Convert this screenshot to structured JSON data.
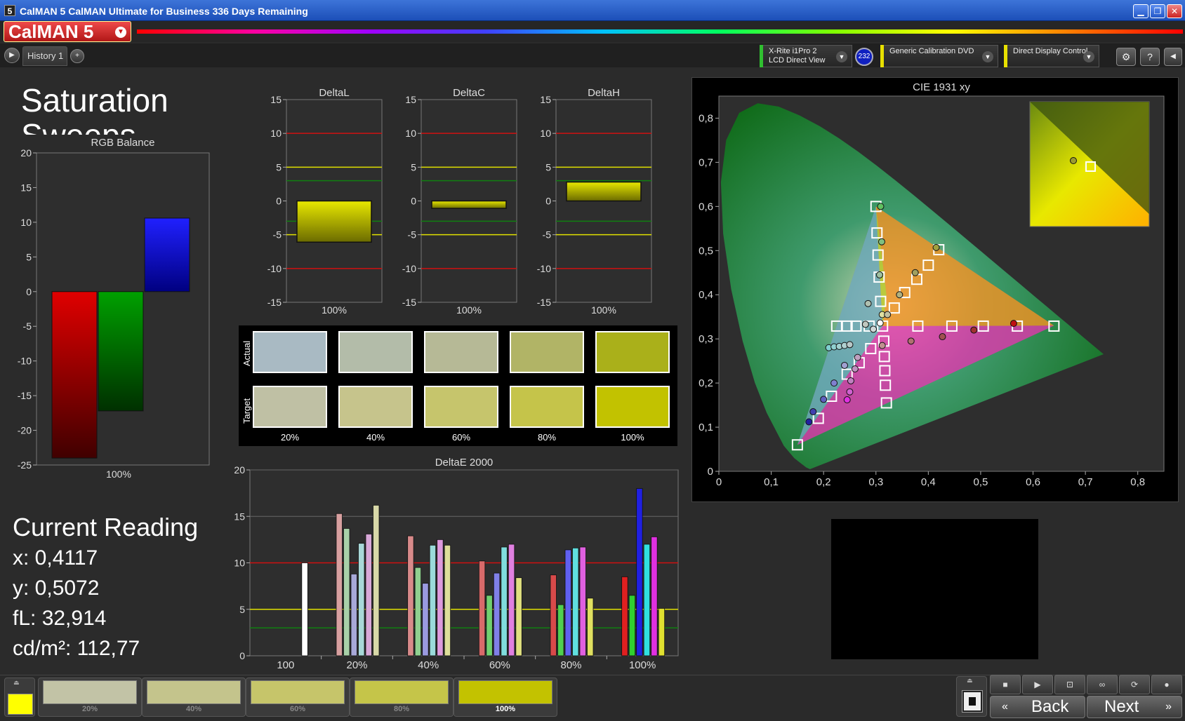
{
  "window": {
    "title": "CalMAN 5 CalMAN Ultimate for Business 336 Days Remaining",
    "logo": "CalMAN 5"
  },
  "tabs": [
    {
      "label": "History 1"
    }
  ],
  "devices": {
    "meter": {
      "line1": "X-Rite i1Pro 2",
      "line2": "LCD Direct View",
      "badge": "232",
      "color": "#30c030"
    },
    "source": {
      "label": "Generic Calibration DVD",
      "color": "#e8e000"
    },
    "display": {
      "label": "Direct Display Control",
      "color": "#e8e000"
    }
  },
  "page": {
    "title": "Saturation Sweeps"
  },
  "current_reading": {
    "heading": "Current Reading",
    "x": "x: 0,4117",
    "y": "y: 0,5072",
    "fl": "fL: 32,914",
    "cdm2": "cd/m²: 112,77"
  },
  "swatches": {
    "row_labels": [
      "Actual",
      "Target"
    ],
    "labels": [
      "20%",
      "40%",
      "60%",
      "80%",
      "100%"
    ],
    "actual_colors": [
      "#a9bac3",
      "#b3bca9",
      "#b6b996",
      "#b1b466",
      "#aab01a"
    ],
    "target_colors": [
      "#bfc0a4",
      "#c6c48c",
      "#c6c56c",
      "#c5c44a",
      "#c2c200"
    ]
  },
  "progress": {
    "labels": [
      "20%",
      "40%",
      "60%",
      "80%",
      "100%"
    ],
    "colors": [
      "#c2c3a6",
      "#c4c48c",
      "#c6c56a",
      "#c5c549",
      "#c3c200"
    ],
    "active_index": 4,
    "current_color": "#ffff00"
  },
  "nav": {
    "back": "Back",
    "next": "Next"
  },
  "chart_data": [
    {
      "type": "bar",
      "title": "RGB Balance",
      "categories": [
        "100%"
      ],
      "series": [
        {
          "values": [
            -24
          ],
          "color": "#e00000"
        },
        {
          "values": [
            -17.2
          ],
          "color": "#00a000"
        },
        {
          "values": [
            10.6
          ],
          "color": "#0000ff"
        }
      ],
      "ylim": [
        -25,
        20
      ],
      "yticks": [
        -25,
        -20,
        -15,
        -10,
        -5,
        0,
        5,
        10,
        15,
        20
      ]
    },
    {
      "type": "bar",
      "title": "DeltaL",
      "categories": [
        "100%"
      ],
      "values": [
        -6.1
      ],
      "ylim": [
        -15,
        15
      ],
      "yticks": [
        -15,
        -10,
        -5,
        0,
        5,
        10,
        15
      ],
      "reference_lines": [
        {
          "y": 10,
          "color": "#d01010"
        },
        {
          "y": -10,
          "color": "#d01010"
        },
        {
          "y": 5,
          "color": "#e0e000"
        },
        {
          "y": -5,
          "color": "#e0e000"
        },
        {
          "y": 3,
          "color": "#108010"
        },
        {
          "y": -3,
          "color": "#108010"
        }
      ]
    },
    {
      "type": "bar",
      "title": "DeltaC",
      "categories": [
        "100%"
      ],
      "values": [
        -1.1
      ],
      "ylim": [
        -15,
        15
      ],
      "yticks": [
        -15,
        -10,
        -5,
        0,
        5,
        10,
        15
      ],
      "reference_lines": [
        {
          "y": 10,
          "color": "#d01010"
        },
        {
          "y": -10,
          "color": "#d01010"
        },
        {
          "y": 5,
          "color": "#e0e000"
        },
        {
          "y": -5,
          "color": "#e0e000"
        },
        {
          "y": 3,
          "color": "#108010"
        },
        {
          "y": -3,
          "color": "#108010"
        }
      ]
    },
    {
      "type": "bar",
      "title": "DeltaH",
      "categories": [
        "100%"
      ],
      "values": [
        2.8
      ],
      "ylim": [
        -15,
        15
      ],
      "yticks": [
        -15,
        -10,
        -5,
        0,
        5,
        10,
        15
      ],
      "reference_lines": [
        {
          "y": 10,
          "color": "#d01010"
        },
        {
          "y": -10,
          "color": "#d01010"
        },
        {
          "y": 5,
          "color": "#e0e000"
        },
        {
          "y": -5,
          "color": "#e0e000"
        },
        {
          "y": 3,
          "color": "#108010"
        },
        {
          "y": -3,
          "color": "#108010"
        }
      ]
    },
    {
      "type": "bar",
      "title": "DeltaE 2000",
      "categories": [
        "100",
        "20%",
        "40%",
        "60%",
        "80%",
        "100%"
      ],
      "ylim": [
        0,
        20
      ],
      "yticks": [
        0,
        5,
        10,
        15,
        20
      ],
      "reference_lines": [
        {
          "y": 10,
          "color": "#d01010"
        },
        {
          "y": 5,
          "color": "#e0e000"
        },
        {
          "y": 3,
          "color": "#108010"
        }
      ],
      "series": [
        {
          "name": "red",
          "values": [
            null,
            15.3,
            12.9,
            10.2,
            8.7,
            8.5
          ],
          "colors": [
            "#ffffff",
            "#d8a0a0",
            "#d88a8a",
            "#d86a6a",
            "#d84a4a",
            "#e02020"
          ]
        },
        {
          "name": "green",
          "values": [
            null,
            13.7,
            9.5,
            6.5,
            5.5,
            6.5
          ],
          "colors": [
            "#ffffff",
            "#a8d0a8",
            "#90d090",
            "#70d070",
            "#50d050",
            "#30d030"
          ]
        },
        {
          "name": "blue",
          "values": [
            null,
            8.8,
            7.8,
            8.9,
            11.4,
            18.0
          ],
          "colors": [
            "#ffffff",
            "#a8a8d8",
            "#9a9ae0",
            "#8080e8",
            "#6060f0",
            "#2020e0"
          ]
        },
        {
          "name": "cyan",
          "values": [
            null,
            12.1,
            11.9,
            11.7,
            11.6,
            12.0
          ],
          "colors": [
            "#ffffff",
            "#a8d8d8",
            "#9adada",
            "#80dddd",
            "#60e0e0",
            "#30e0e0"
          ]
        },
        {
          "name": "magenta",
          "values": [
            null,
            13.1,
            12.5,
            12.0,
            11.7,
            12.8
          ],
          "colors": [
            "#ffffff",
            "#d8a8d8",
            "#dd9add",
            "#e080e0",
            "#e060e0",
            "#e030e0"
          ]
        },
        {
          "name": "yellow",
          "values": [
            10.0,
            16.2,
            11.9,
            8.4,
            6.2,
            5.1
          ],
          "colors": [
            "#ffffff",
            "#d8d8a8",
            "#dede9a",
            "#e0e080",
            "#e0e060",
            "#e0e030"
          ]
        }
      ]
    },
    {
      "type": "scatter",
      "title": "CIE 1931 xy",
      "xlim": [
        0,
        0.85
      ],
      "ylim": [
        0,
        0.85
      ],
      "xticks": [
        0,
        0.1,
        0.2,
        0.3,
        0.4,
        0.5,
        0.6,
        0.7,
        0.8
      ],
      "xtick_labels": [
        "0",
        "0,1",
        "0,2",
        "0,3",
        "0,4",
        "0,5",
        "0,6",
        "0,7",
        "0,8"
      ],
      "yticks": [
        0,
        0.1,
        0.2,
        0.3,
        0.4,
        0.5,
        0.6,
        0.7,
        0.8
      ],
      "ytick_labels": [
        "0",
        "0,1",
        "0,2",
        "0,3",
        "0,4",
        "0,5",
        "0,6",
        "0,7",
        "0,8"
      ],
      "gamut": {
        "red": [
          0.64,
          0.33
        ],
        "green": [
          0.3,
          0.6
        ],
        "blue": [
          0.15,
          0.06
        ]
      },
      "white": [
        0.3127,
        0.329
      ],
      "targets": [
        [
          0.225,
          0.329
        ],
        [
          0.245,
          0.329
        ],
        [
          0.262,
          0.329
        ],
        [
          0.287,
          0.329
        ],
        [
          0.3127,
          0.329
        ],
        [
          0.3,
          0.6
        ],
        [
          0.302,
          0.54
        ],
        [
          0.304,
          0.49
        ],
        [
          0.306,
          0.44
        ],
        [
          0.309,
          0.385
        ],
        [
          0.38,
          0.329
        ],
        [
          0.445,
          0.329
        ],
        [
          0.505,
          0.329
        ],
        [
          0.57,
          0.329
        ],
        [
          0.64,
          0.329
        ],
        [
          0.315,
          0.295
        ],
        [
          0.316,
          0.26
        ],
        [
          0.317,
          0.228
        ],
        [
          0.318,
          0.195
        ],
        [
          0.32,
          0.155
        ],
        [
          0.29,
          0.278
        ],
        [
          0.268,
          0.246
        ],
        [
          0.245,
          0.22
        ],
        [
          0.215,
          0.17
        ],
        [
          0.19,
          0.12
        ],
        [
          0.15,
          0.06
        ],
        [
          0.335,
          0.37
        ],
        [
          0.355,
          0.405
        ],
        [
          0.378,
          0.435
        ],
        [
          0.4,
          0.467
        ],
        [
          0.42,
          0.502
        ]
      ],
      "measured": [
        {
          "x": 0.309,
          "y": 0.6,
          "c": "#60c060"
        },
        {
          "x": 0.311,
          "y": 0.52,
          "c": "#80c080"
        },
        {
          "x": 0.307,
          "y": 0.445,
          "c": "#a0c0a0"
        },
        {
          "x": 0.285,
          "y": 0.38,
          "c": "#b0c0b0"
        },
        {
          "x": 0.28,
          "y": 0.333,
          "c": "#c0c8c0"
        },
        {
          "x": 0.295,
          "y": 0.322,
          "c": "#d0d8d8"
        },
        {
          "x": 0.308,
          "y": 0.336,
          "c": "#ffffff"
        },
        {
          "x": 0.312,
          "y": 0.355,
          "c": "#e0e0a0"
        },
        {
          "x": 0.21,
          "y": 0.28,
          "c": "#80d0d0"
        },
        {
          "x": 0.22,
          "y": 0.282,
          "c": "#90d0d0"
        },
        {
          "x": 0.23,
          "y": 0.283,
          "c": "#a0d0d0"
        },
        {
          "x": 0.24,
          "y": 0.285,
          "c": "#b0d0d0"
        },
        {
          "x": 0.25,
          "y": 0.287,
          "c": "#b8c8c8"
        },
        {
          "x": 0.265,
          "y": 0.258,
          "c": "#c0a0c0"
        },
        {
          "x": 0.26,
          "y": 0.232,
          "c": "#c090c0"
        },
        {
          "x": 0.252,
          "y": 0.205,
          "c": "#c080c0"
        },
        {
          "x": 0.25,
          "y": 0.18,
          "c": "#d060d0"
        },
        {
          "x": 0.245,
          "y": 0.162,
          "c": "#e030e0"
        },
        {
          "x": 0.24,
          "y": 0.24,
          "c": "#a0a0d0"
        },
        {
          "x": 0.22,
          "y": 0.2,
          "c": "#8080d0"
        },
        {
          "x": 0.2,
          "y": 0.163,
          "c": "#6060c0"
        },
        {
          "x": 0.18,
          "y": 0.135,
          "c": "#4040b0"
        },
        {
          "x": 0.172,
          "y": 0.112,
          "c": "#2020a0"
        },
        {
          "x": 0.312,
          "y": 0.285,
          "c": "#c09090"
        },
        {
          "x": 0.367,
          "y": 0.295,
          "c": "#b07070"
        },
        {
          "x": 0.427,
          "y": 0.305,
          "c": "#a05050"
        },
        {
          "x": 0.487,
          "y": 0.32,
          "c": "#a03030"
        },
        {
          "x": 0.563,
          "y": 0.335,
          "c": "#c01010"
        },
        {
          "x": 0.322,
          "y": 0.355,
          "c": "#c0c0a0"
        },
        {
          "x": 0.345,
          "y": 0.4,
          "c": "#b0b080"
        },
        {
          "x": 0.375,
          "y": 0.45,
          "c": "#a0a060"
        },
        {
          "x": 0.415,
          "y": 0.507,
          "c": "#a0a040"
        }
      ],
      "inset_point": {
        "x": 0.4117,
        "y": 0.5072
      }
    }
  ]
}
